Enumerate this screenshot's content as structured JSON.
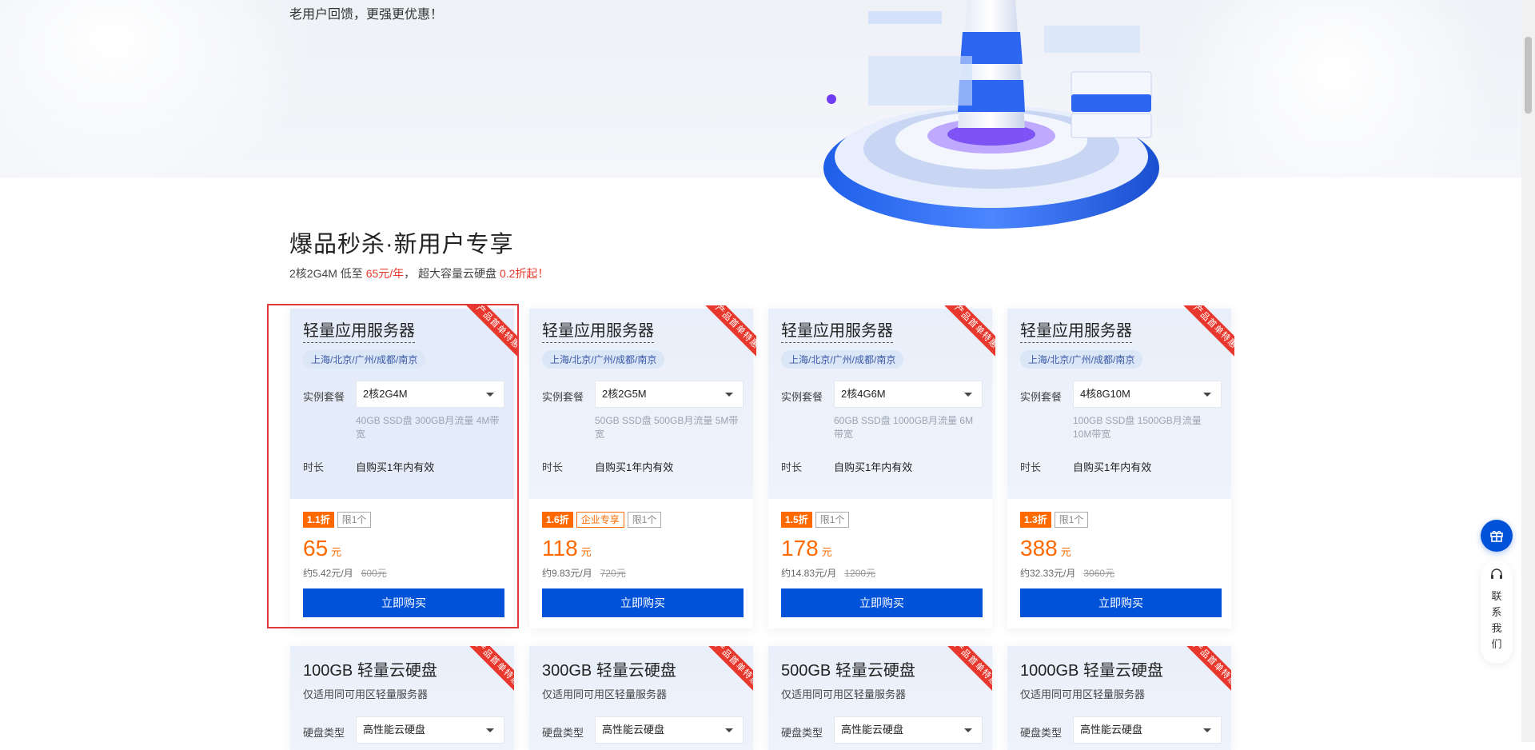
{
  "banner": {
    "subtitle": "老用户回馈，更强更优惠！"
  },
  "section": {
    "title": "爆品秒杀·新用户专享",
    "sub_prefix": "2核2G4M 低至 ",
    "sub_price": "65元/年",
    "sub_mid": "， 超大容量云硬盘 ",
    "sub_discount": "0.2折起",
    "sub_end": "！"
  },
  "ribbon_text": "产品首单特惠",
  "labels": {
    "package": "实例套餐",
    "duration": "时长",
    "disk_type": "硬盘类型",
    "buy": "立即购买",
    "limit": "限1个",
    "enterprise": "企业专享",
    "yuan": "元"
  },
  "servers": [
    {
      "title": "轻量应用服务器",
      "regions": "上海/北京/广州/成都/南京",
      "package": "2核2G4M",
      "spec": "40GB SSD盘 300GB月流量 4M带宽",
      "duration": "自购买1年内有效",
      "discount": "1.1折",
      "enterprise": false,
      "price": "65",
      "monthly": "约5.42元/月",
      "original": "600元"
    },
    {
      "title": "轻量应用服务器",
      "regions": "上海/北京/广州/成都/南京",
      "package": "2核2G5M",
      "spec": "50GB SSD盘 500GB月流量 5M带宽",
      "duration": "自购买1年内有效",
      "discount": "1.6折",
      "enterprise": true,
      "price": "118",
      "monthly": "约9.83元/月",
      "original": "720元"
    },
    {
      "title": "轻量应用服务器",
      "regions": "上海/北京/广州/成都/南京",
      "package": "2核4G6M",
      "spec": "60GB SSD盘 1000GB月流量 6M带宽",
      "duration": "自购买1年内有效",
      "discount": "1.5折",
      "enterprise": false,
      "price": "178",
      "monthly": "约14.83元/月",
      "original": "1200元"
    },
    {
      "title": "轻量应用服务器",
      "regions": "上海/北京/广州/成都/南京",
      "package": "4核8G10M",
      "spec": "100GB SSD盘 1500GB月流量 10M带宽",
      "duration": "自购买1年内有效",
      "discount": "1.3折",
      "enterprise": false,
      "price": "388",
      "monthly": "约32.33元/月",
      "original": "3060元"
    }
  ],
  "disks": [
    {
      "title": "100GB 轻量云硬盘",
      "sub": "仅适用同可用区轻量服务器",
      "disk_type": "高性能云硬盘"
    },
    {
      "title": "300GB 轻量云硬盘",
      "sub": "仅适用同可用区轻量服务器",
      "disk_type": "高性能云硬盘"
    },
    {
      "title": "500GB 轻量云硬盘",
      "sub": "仅适用同可用区轻量服务器",
      "disk_type": "高性能云硬盘"
    },
    {
      "title": "1000GB 轻量云硬盘",
      "sub": "仅适用同可用区轻量服务器",
      "disk_type": "高性能云硬盘"
    }
  ],
  "side": {
    "contact": "联系我们",
    "gift_icon": "gift-icon",
    "headset_icon": "headset-icon"
  },
  "colors": {
    "brand": "#0052d9",
    "discount": "#ff6a00",
    "red": "#e8382d"
  }
}
